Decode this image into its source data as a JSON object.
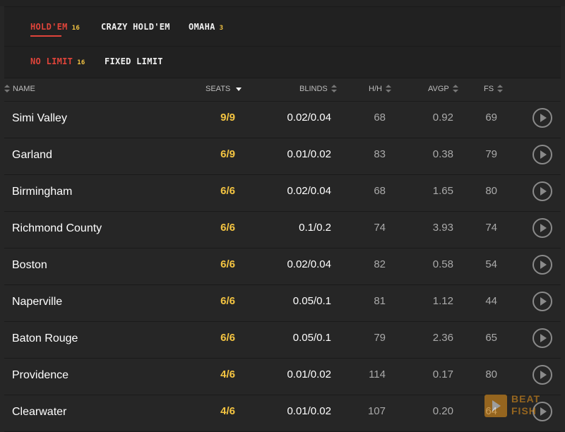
{
  "game_tabs": [
    {
      "label": "HOLD'EM",
      "count": "16",
      "active": true
    },
    {
      "label": "CRAZY HOLD'EM",
      "count": "",
      "active": false
    },
    {
      "label": "OMAHA",
      "count": "3",
      "active": false
    }
  ],
  "limit_tabs": [
    {
      "label": "NO LIMIT",
      "count": "16",
      "active": true
    },
    {
      "label": "FIXED LIMIT",
      "count": "",
      "active": false
    }
  ],
  "columns": {
    "name": "NAME",
    "seats": "SEATS",
    "blinds": "BLINDS",
    "hh": "H/H",
    "avgp": "AVGP",
    "fs": "FS"
  },
  "tables": [
    {
      "name": "Simi Valley",
      "seats": "9/9",
      "blinds": "0.02/0.04",
      "hh": "68",
      "avgp": "0.92",
      "fs": "69"
    },
    {
      "name": "Garland",
      "seats": "6/9",
      "blinds": "0.01/0.02",
      "hh": "83",
      "avgp": "0.38",
      "fs": "79"
    },
    {
      "name": "Birmingham",
      "seats": "6/6",
      "blinds": "0.02/0.04",
      "hh": "68",
      "avgp": "1.65",
      "fs": "80"
    },
    {
      "name": "Richmond County",
      "seats": "6/6",
      "blinds": "0.1/0.2",
      "hh": "74",
      "avgp": "3.93",
      "fs": "74"
    },
    {
      "name": "Boston",
      "seats": "6/6",
      "blinds": "0.02/0.04",
      "hh": "82",
      "avgp": "0.58",
      "fs": "54"
    },
    {
      "name": "Naperville",
      "seats": "6/6",
      "blinds": "0.05/0.1",
      "hh": "81",
      "avgp": "1.12",
      "fs": "44"
    },
    {
      "name": "Baton Rouge",
      "seats": "6/6",
      "blinds": "0.05/0.1",
      "hh": "79",
      "avgp": "2.36",
      "fs": "65"
    },
    {
      "name": "Providence",
      "seats": "4/6",
      "blinds": "0.01/0.02",
      "hh": "114",
      "avgp": "0.17",
      "fs": "80"
    },
    {
      "name": "Clearwater",
      "seats": "4/6",
      "blinds": "0.01/0.02",
      "hh": "107",
      "avgp": "0.20",
      "fs": "64"
    }
  ],
  "watermark": {
    "line1": "BEAT",
    "line2": "FISH"
  },
  "colors": {
    "accent_red": "#e0443a",
    "accent_gold": "#f5c542",
    "background": "#262626"
  }
}
